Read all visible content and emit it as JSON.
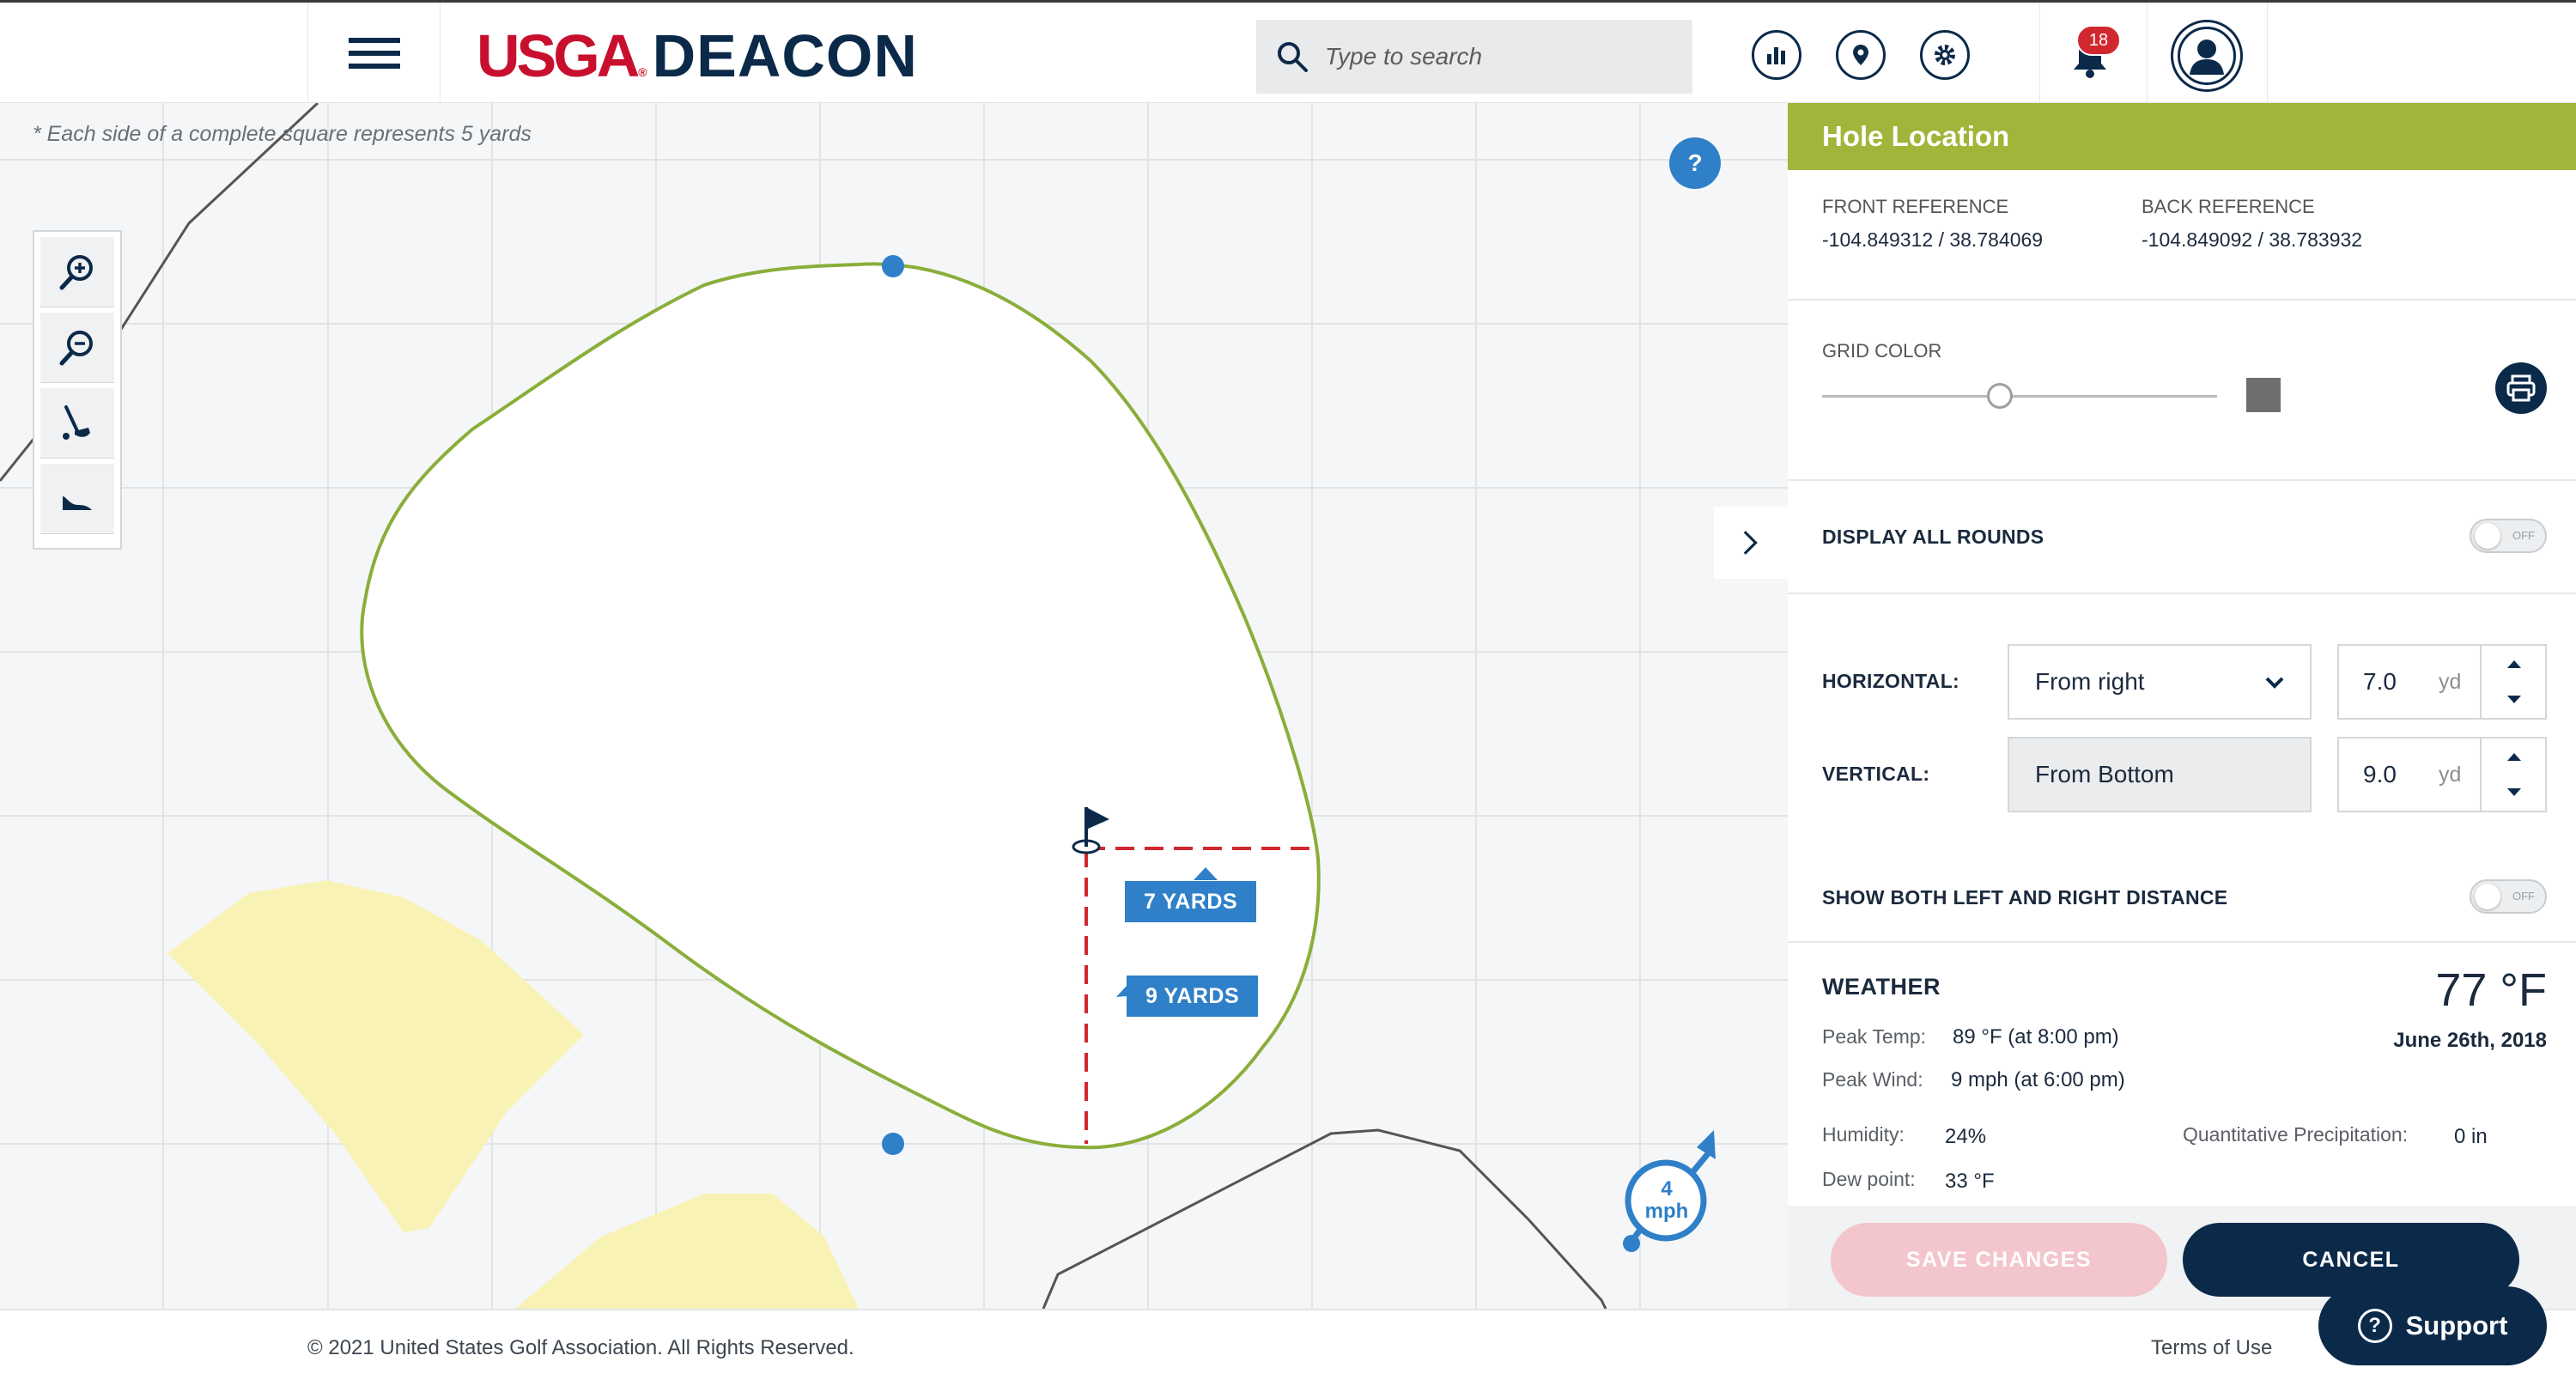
{
  "header": {
    "logo_usga": "USGA",
    "logo_reg": "®",
    "logo_app": "DEACON",
    "search_placeholder": "Type to search",
    "notification_count": "18"
  },
  "map": {
    "grid_note": "* Each side of a complete square represents 5 yards",
    "help_label": "?",
    "horizontal_label": "7 YARDS",
    "vertical_label": "9 YARDS",
    "wind_speed": "4",
    "wind_unit": "mph"
  },
  "panel": {
    "title": "Hole Location",
    "front_ref_label": "FRONT REFERENCE",
    "front_ref_value": "-104.849312 / 38.784069",
    "back_ref_label": "BACK REFERENCE",
    "back_ref_value": "-104.849092 / 38.783932",
    "grid_color_label": "GRID COLOR",
    "grid_color_level": 0.45,
    "grid_color_swatch": "#6e6e6e",
    "display_all_rounds_label": "DISPLAY ALL ROUNDS",
    "toggle_off_text": "OFF",
    "horizontal_label": "HORIZONTAL:",
    "horizontal_select": "From right",
    "horizontal_value": "7.0",
    "vertical_label": "VERTICAL:",
    "vertical_select": "From Bottom",
    "vertical_value": "9.0",
    "unit": "yd",
    "show_both_label": "SHOW BOTH LEFT AND RIGHT DISTANCE",
    "weather": {
      "title": "WEATHER",
      "temp": "77 °F",
      "date": "June 26th, 2018",
      "peak_temp_label": "Peak Temp:",
      "peak_temp_value": "89 °F (at 8:00 pm)",
      "peak_wind_label": "Peak Wind:",
      "peak_wind_value": "9 mph (at 6:00 pm)",
      "humidity_label": "Humidity:",
      "humidity_value": "24%",
      "precip_label": "Quantitative Precipitation:",
      "precip_value": "0 in",
      "dew_label": "Dew point:",
      "dew_value": "33 °F"
    },
    "save_label": "SAVE CHANGES",
    "cancel_label": "CANCEL"
  },
  "footer": {
    "copyright": "© 2021 United States Golf Association. All Rights Reserved.",
    "terms": "Terms of Use",
    "support": "Support"
  },
  "colors": {
    "brand_navy": "#0b2a4a",
    "brand_red": "#c8102e",
    "panel_header": "#a3b43a",
    "accent_blue": "#2f80c8",
    "green_outline": "#8aae3a",
    "measure_red": "#d0282e",
    "bunker": "#f8f3b5"
  }
}
